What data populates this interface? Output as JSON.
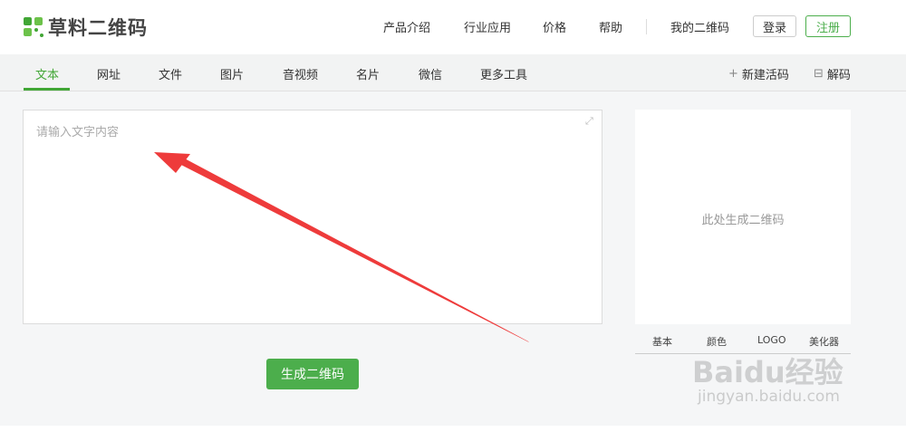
{
  "header": {
    "logo_text": "草料二维码",
    "nav": [
      "产品介绍",
      "行业应用",
      "价格",
      "帮助"
    ],
    "my_qr": "我的二维码",
    "login": "登录",
    "register": "注册"
  },
  "subnav": {
    "tabs": [
      "文本",
      "网址",
      "文件",
      "图片",
      "音视频",
      "名片",
      "微信",
      "更多工具"
    ],
    "active_tab": "文本",
    "new_live_code": "新建活码",
    "decode": "解码"
  },
  "editor": {
    "placeholder": "请输入文字内容",
    "value": ""
  },
  "generate_button": "生成二维码",
  "preview": {
    "placeholder_text": "此处生成二维码",
    "style_tabs": [
      "基本",
      "颜色",
      "LOGO",
      "美化器"
    ]
  },
  "watermark": {
    "main": "Baidu经验",
    "sub": "jingyan.baidu.com"
  },
  "colors": {
    "brand_green": "#41a635",
    "button_green": "#4cae4c",
    "annotation_red": "#ee3b3b"
  }
}
